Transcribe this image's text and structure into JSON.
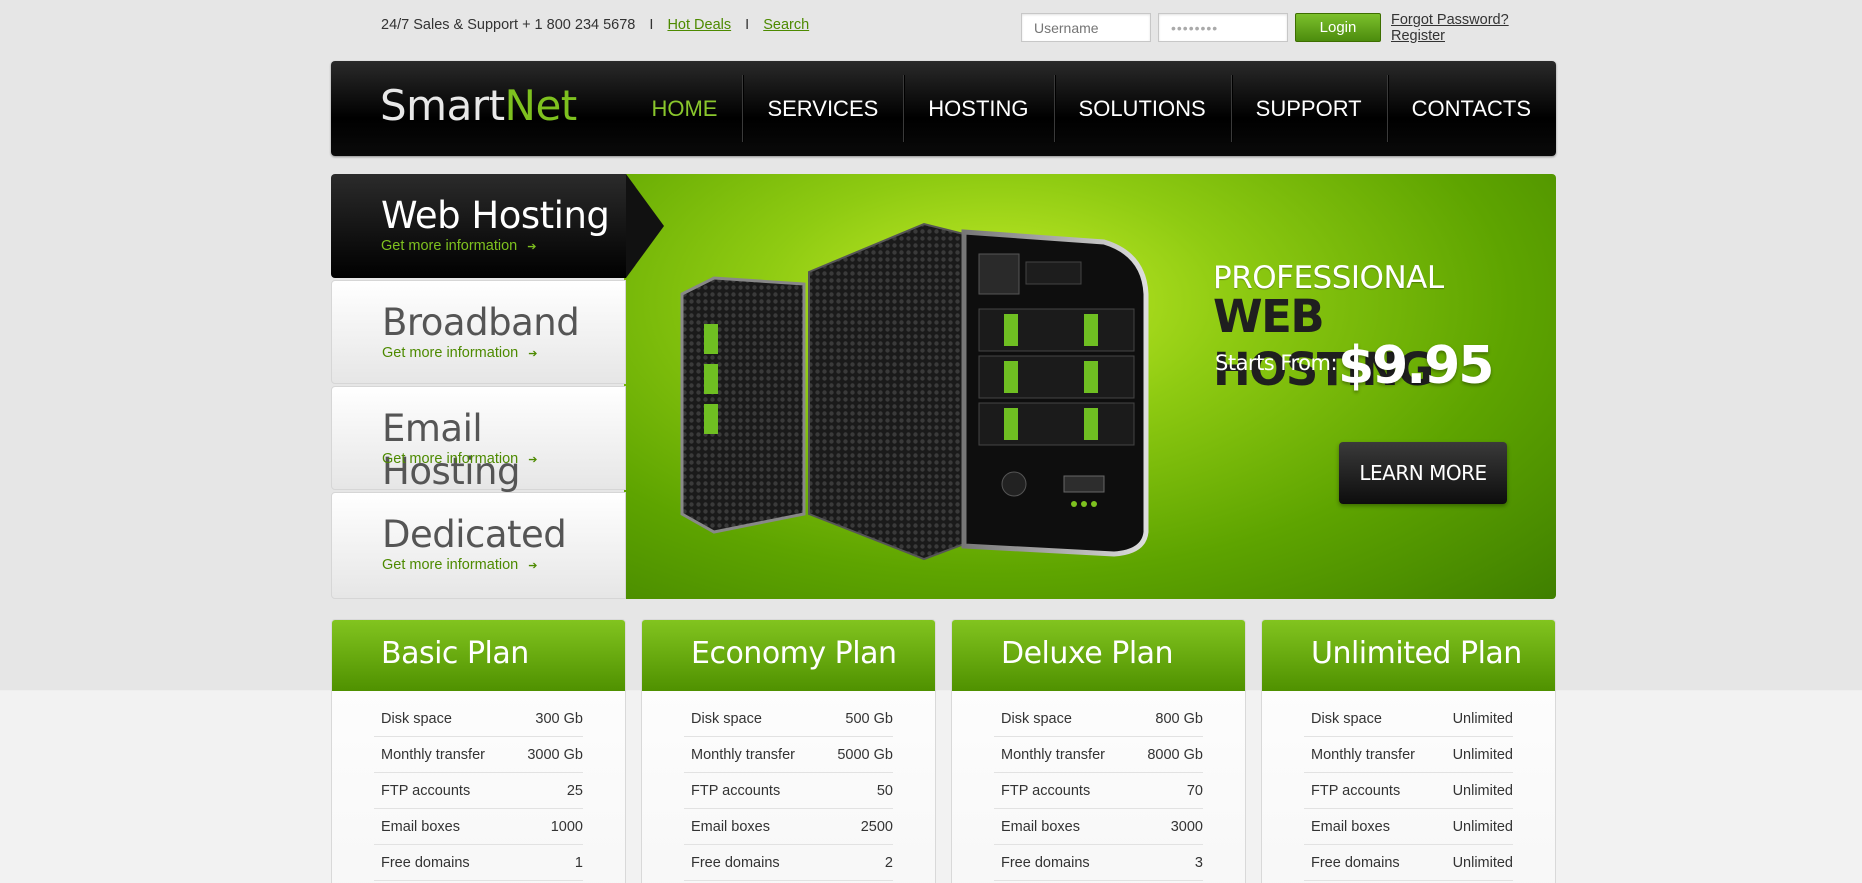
{
  "topbar": {
    "support_text": "24/7 Sales & Support + 1 800 234 5678",
    "separator": "I",
    "hot_deals": "Hot Deals",
    "search": "Search",
    "username_placeholder": "Username",
    "password_value": "••••••••",
    "login_label": "Login",
    "forgot_password": "Forgot Password?",
    "register": "Register"
  },
  "header": {
    "logo_part1": "Smart",
    "logo_part2": "Net",
    "nav": [
      {
        "label": "HOME",
        "active": true
      },
      {
        "label": "SERVICES"
      },
      {
        "label": "HOSTING"
      },
      {
        "label": "SOLUTIONS"
      },
      {
        "label": "SUPPORT"
      },
      {
        "label": "CONTACTS"
      }
    ]
  },
  "slider": {
    "tabs": [
      {
        "title": "Web Hosting",
        "more": "Get more information"
      },
      {
        "title": "Broadband",
        "more": "Get more information"
      },
      {
        "title": "Email Hosting",
        "more": "Get more information"
      },
      {
        "title": "Dedicated",
        "more": "Get more information"
      }
    ],
    "banner": {
      "line1": "PROFESSIONAL",
      "line2": "WEB HOSTING",
      "starts_from": "Starts From:",
      "price": "$9.95",
      "button": "LEARN MORE"
    }
  },
  "plans": [
    {
      "name": "Basic Plan",
      "rows": [
        [
          "Disk space",
          "300 Gb"
        ],
        [
          "Monthly transfer",
          "3000 Gb"
        ],
        [
          "FTP accounts",
          "25"
        ],
        [
          "Email boxes",
          "1000"
        ],
        [
          "Free domains",
          "1"
        ]
      ]
    },
    {
      "name": "Economy Plan",
      "rows": [
        [
          "Disk space",
          "500 Gb"
        ],
        [
          "Monthly transfer",
          "5000 Gb"
        ],
        [
          "FTP accounts",
          "50"
        ],
        [
          "Email boxes",
          "2500"
        ],
        [
          "Free domains",
          "2"
        ]
      ]
    },
    {
      "name": "Deluxe Plan",
      "rows": [
        [
          "Disk space",
          "800 Gb"
        ],
        [
          "Monthly transfer",
          "8000 Gb"
        ],
        [
          "FTP accounts",
          "70"
        ],
        [
          "Email boxes",
          "3000"
        ],
        [
          "Free domains",
          "3"
        ]
      ]
    },
    {
      "name": "Unlimited Plan",
      "rows": [
        [
          "Disk space",
          "Unlimited"
        ],
        [
          "Monthly transfer",
          "Unlimited"
        ],
        [
          "FTP accounts",
          "Unlimited"
        ],
        [
          "Email boxes",
          "Unlimited"
        ],
        [
          "Free domains",
          "Unlimited"
        ]
      ]
    }
  ],
  "colors": {
    "accent_green": "#7ec11f",
    "dark": "#000000"
  }
}
